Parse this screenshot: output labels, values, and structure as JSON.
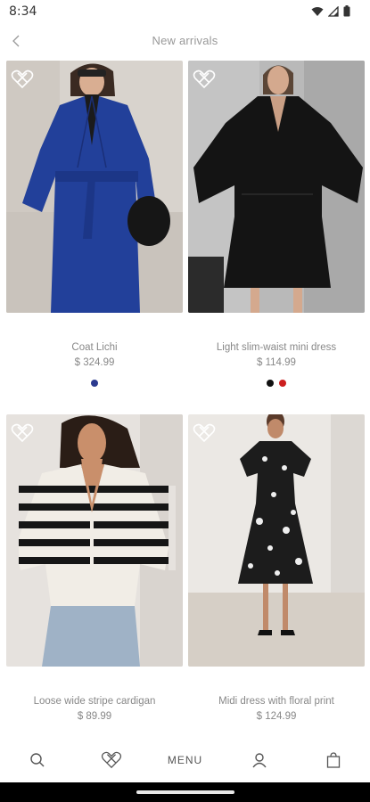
{
  "status": {
    "time": "8:34"
  },
  "header": {
    "title": "New arrivals"
  },
  "products": [
    {
      "name": "Coat Lichi",
      "price": "$ 324.99",
      "swatches": [
        "#2b3a8f"
      ],
      "photo": "blue-coat"
    },
    {
      "name": "Light slim-waist mini dress",
      "price": "$ 114.99",
      "swatches": [
        "#111111",
        "#cc1f1f"
      ],
      "photo": "black-dress"
    },
    {
      "name": "Loose wide stripe cardigan",
      "price": "$ 89.99",
      "swatches": [],
      "photo": "stripe-cardigan"
    },
    {
      "name": "Midi dress with floral print",
      "price": "$ 124.99",
      "swatches": [],
      "photo": "floral-dress"
    }
  ],
  "nav": {
    "menu_label": "MENU"
  },
  "colors": {
    "accent": "#555555",
    "muted": "#888888"
  }
}
